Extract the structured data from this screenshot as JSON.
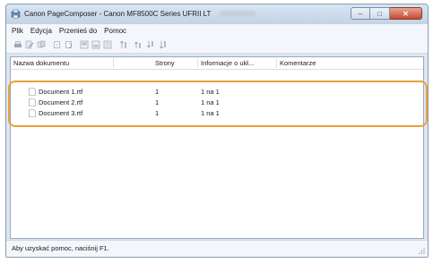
{
  "window": {
    "title": "Canon PageComposer - Canon MF8500C Series UFRII LT",
    "minimize": "–",
    "maximize": "□",
    "close": "✕"
  },
  "menu": [
    "Plik",
    "Edycja",
    "Przenieś do",
    "Pomoc"
  ],
  "toolbar_icons": [
    "print-icon",
    "edit-icon",
    "merge-icon",
    "copy-icon",
    "paste-icon",
    "preview-icon",
    "preview2-icon",
    "settings-icon",
    "move-top-icon",
    "move-up-icon",
    "move-down-icon",
    "move-bottom-icon"
  ],
  "table": {
    "columns": [
      "Nazwa dokumentu",
      "Strony",
      "Informacje o ukł...",
      "Komentarze"
    ],
    "rows": [
      {
        "name": "Document 1.rtf",
        "pages": "1",
        "layout": "1 na 1",
        "comments": ""
      },
      {
        "name": "Document 2.rtf",
        "pages": "1",
        "layout": "1 na 1",
        "comments": ""
      },
      {
        "name": "Document 3.rtf",
        "pages": "1",
        "layout": "1 na 1",
        "comments": ""
      }
    ]
  },
  "status": "Aby uzyskać pomoc, naciśnij F1.",
  "colors": {
    "highlight": "#e8a13a",
    "titlebar": "#c2d3e6"
  }
}
